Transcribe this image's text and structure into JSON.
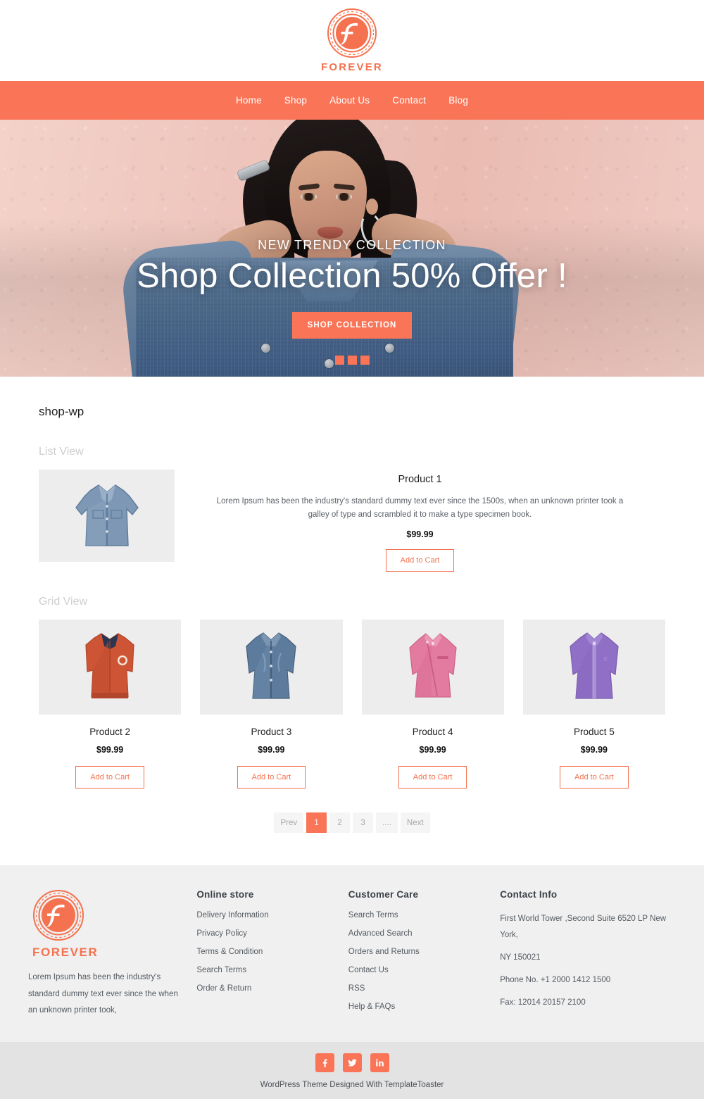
{
  "brand": {
    "name": "FOREVER",
    "accent": "#fa7557",
    "logo_icon": "forever-circular-monogram"
  },
  "nav": {
    "items": [
      {
        "label": "Home"
      },
      {
        "label": "Shop"
      },
      {
        "label": "About Us"
      },
      {
        "label": "Contact"
      },
      {
        "label": "Blog"
      }
    ]
  },
  "hero": {
    "eyebrow": "NEW TRENDY COLLECTION",
    "title": "Shop Collection 50% Offer !",
    "button": "SHOP COLLECTION",
    "dots": 3
  },
  "shop": {
    "page_title": "shop-wp",
    "list_view_label": "List View",
    "grid_view_label": "Grid View",
    "add_to_cart": "Add to Cart",
    "list_products": [
      {
        "name": "Product 1",
        "description": "Lorem Ipsum has been the industry's standard dummy text ever since the 1500s, when an unknown printer took a galley of type and scrambled it to make a type specimen book.",
        "price": "$99.99",
        "image": "denim-jacket-flat-lay"
      }
    ],
    "grid_products": [
      {
        "name": "Product 2",
        "price": "$99.99",
        "image": "orange-bomber-jacket"
      },
      {
        "name": "Product 3",
        "price": "$99.99",
        "image": "blue-denim-jacket"
      },
      {
        "name": "Product 4",
        "price": "$99.99",
        "image": "pink-moto-jacket"
      },
      {
        "name": "Product 5",
        "price": "$99.99",
        "image": "purple-fleece-jacket"
      }
    ],
    "pagination": {
      "prev": "Prev",
      "next": "Next",
      "pages": [
        "1",
        "2",
        "3",
        "...."
      ],
      "active": "1"
    }
  },
  "footer": {
    "brand_name": "FOREVER",
    "about": "Lorem Ipsum has been the industry's standard dummy text ever since the   when an unknown printer took,",
    "columns": [
      {
        "heading": "Online store",
        "links": [
          {
            "label": "Delivery Information"
          },
          {
            "label": "Privacy Policy"
          },
          {
            "label": "Terms & Condition"
          },
          {
            "label": "Search Terms"
          },
          {
            "label": "Order & Return"
          }
        ]
      },
      {
        "heading": "Customer Care",
        "links": [
          {
            "label": "Search Terms"
          },
          {
            "label": "Advanced Search"
          },
          {
            "label": "Orders and Returns"
          },
          {
            "label": "Contact Us"
          },
          {
            "label": "RSS"
          },
          {
            "label": "Help & FAQs"
          }
        ]
      }
    ],
    "contact": {
      "heading": "Contact Info",
      "address_line1": "First World Tower ,Second Suite 6520 LP New York,",
      "address_line2": "NY 150021",
      "phone": "Phone No. +1 2000 1412 1500",
      "fax": "Fax: 12014 20157 2100"
    },
    "socials": [
      {
        "name": "facebook-icon"
      },
      {
        "name": "twitter-icon"
      },
      {
        "name": "linkedin-icon"
      }
    ],
    "copyright": "WordPress Theme Designed With TemplateToaster"
  }
}
